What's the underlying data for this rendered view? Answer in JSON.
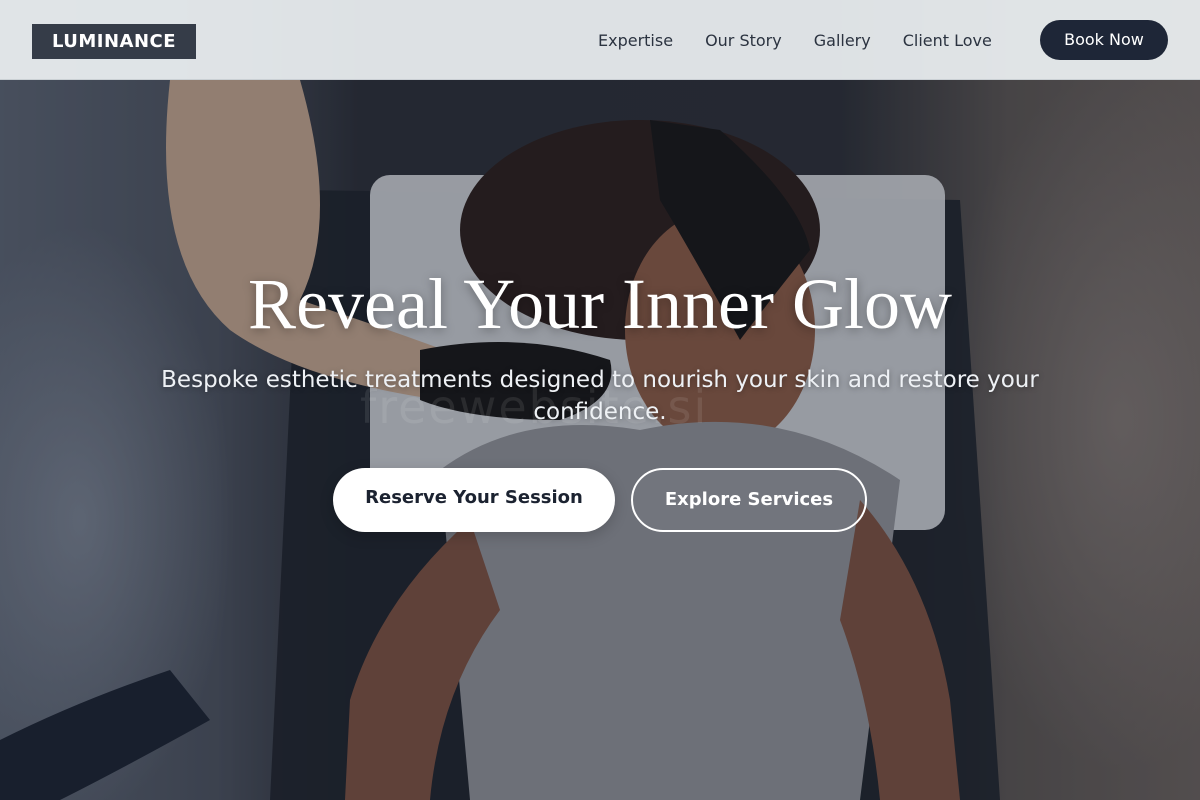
{
  "header": {
    "logo": "LUMINANCE",
    "nav": [
      {
        "label": "Expertise"
      },
      {
        "label": "Our Story"
      },
      {
        "label": "Gallery"
      },
      {
        "label": "Client Love"
      }
    ],
    "cta_label": "Book Now"
  },
  "hero": {
    "title": "Reveal Your Inner Glow",
    "subtitle": "Bespoke esthetic treatments designed to nourish your skin and restore your confidence.",
    "primary_button": "Reserve Your Session",
    "secondary_button": "Explore Services",
    "watermark": "freewebsite.si"
  },
  "colors": {
    "header_bg": "#ecf0f2",
    "logo_bg": "#353c48",
    "book_button_bg": "#1e2637",
    "nav_text": "#2b3340",
    "hero_text": "#ffffff"
  }
}
